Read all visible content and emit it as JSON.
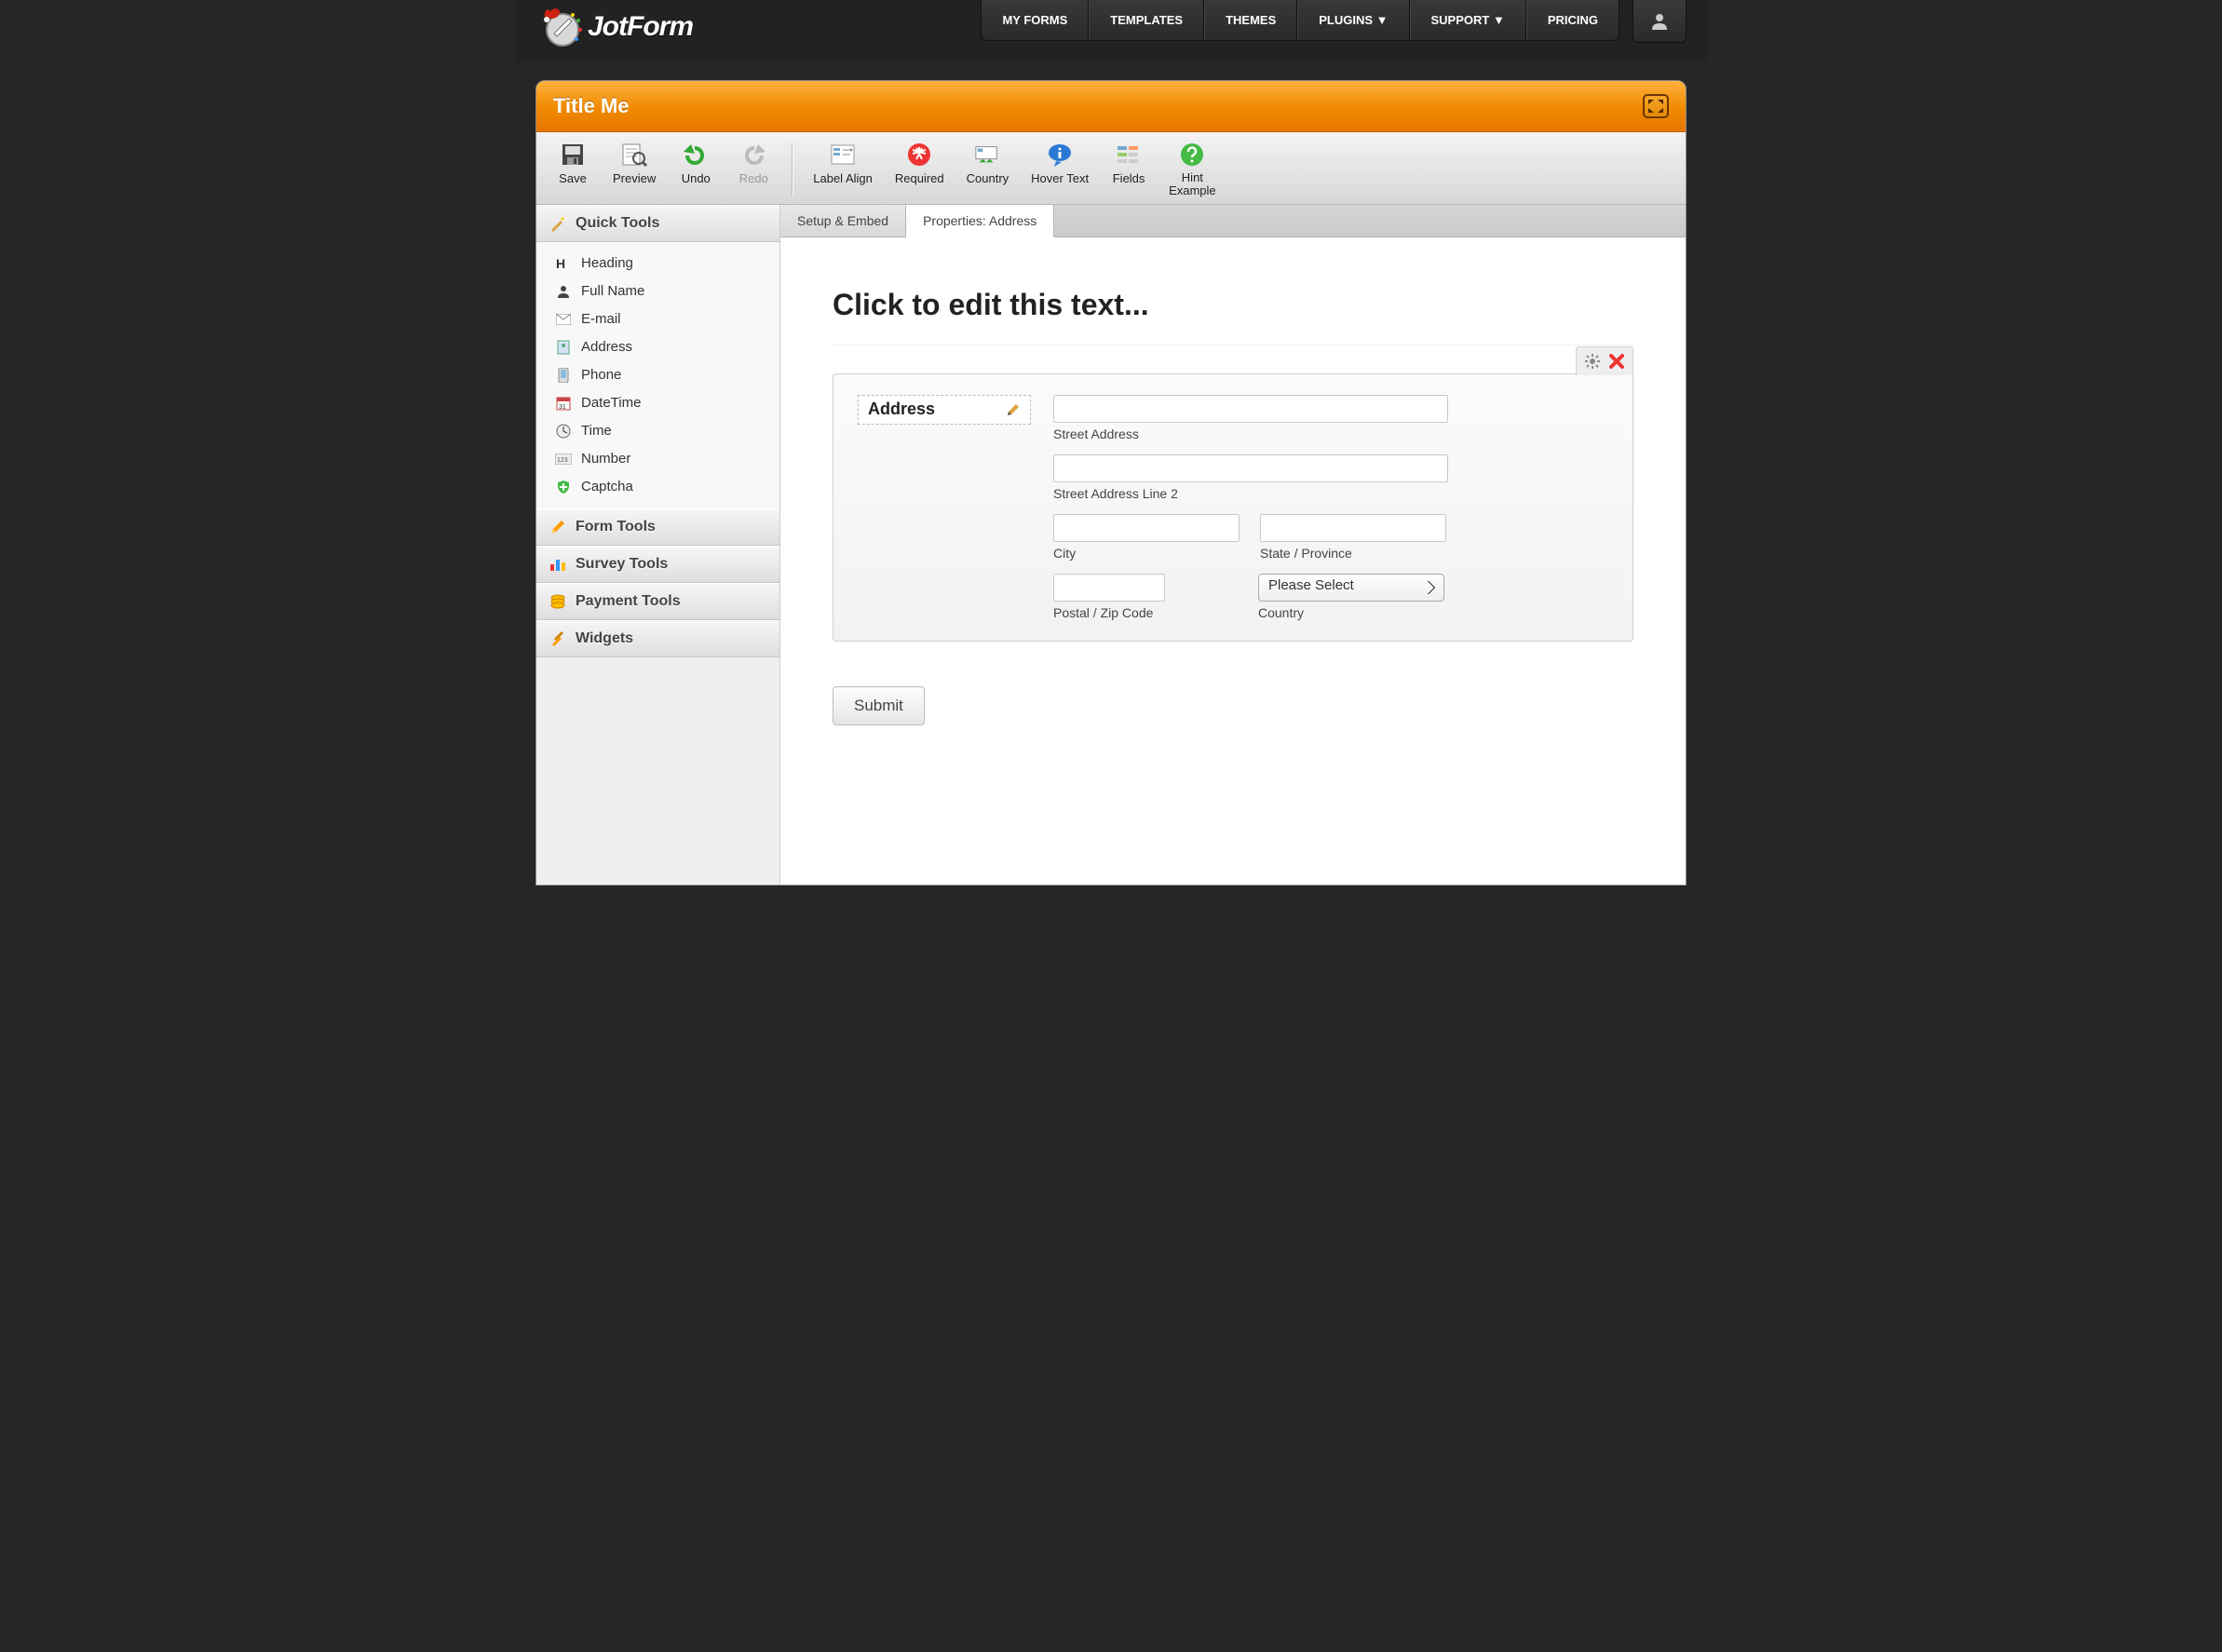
{
  "nav": {
    "items": [
      "MY FORMS",
      "TEMPLATES",
      "THEMES",
      "PLUGINS ▼",
      "SUPPORT ▼",
      "PRICING"
    ]
  },
  "logo": {
    "text": "JotForm"
  },
  "workspace": {
    "title": "Title Me"
  },
  "toolbar": {
    "save": "Save",
    "preview": "Preview",
    "undo": "Undo",
    "redo": "Redo",
    "labelAlign": "Label Align",
    "required": "Required",
    "country": "Country",
    "hoverText": "Hover Text",
    "fields": "Fields",
    "hintExample": "Hint\nExample"
  },
  "tabs": {
    "setup": "Setup & Embed",
    "properties": "Properties: Address"
  },
  "sidebar": {
    "quickTools": "Quick Tools",
    "formTools": "Form Tools",
    "surveyTools": "Survey Tools",
    "paymentTools": "Payment Tools",
    "widgets": "Widgets",
    "items": [
      {
        "label": "Heading"
      },
      {
        "label": "Full Name"
      },
      {
        "label": "E-mail"
      },
      {
        "label": "Address"
      },
      {
        "label": "Phone"
      },
      {
        "label": "DateTime"
      },
      {
        "label": "Time"
      },
      {
        "label": "Number"
      },
      {
        "label": "Captcha"
      }
    ]
  },
  "form": {
    "heading": "Click to edit this text...",
    "addressField": {
      "label": "Address",
      "street": "Street Address",
      "street2": "Street Address Line 2",
      "city": "City",
      "state": "State / Province",
      "postal": "Postal / Zip Code",
      "country": "Country",
      "countryPlaceholder": "Please Select"
    },
    "submit": "Submit"
  }
}
